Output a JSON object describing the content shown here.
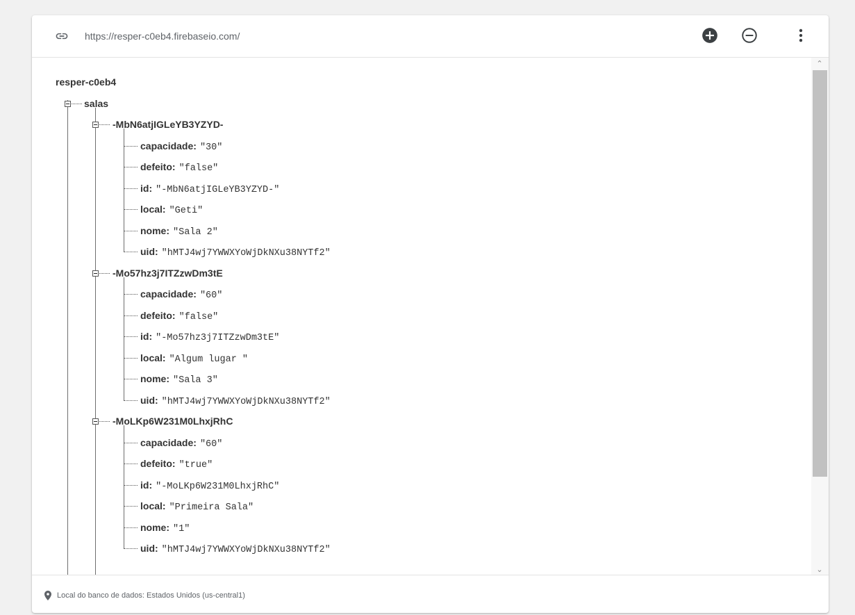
{
  "header": {
    "url": "https://resper-c0eb4.firebaseio.com/",
    "icons": {
      "link": "link-icon",
      "add": "add-circle-icon",
      "remove": "remove-circle-icon",
      "more": "more-vert-icon"
    }
  },
  "tree": {
    "root": "resper-c0eb4",
    "collection": "salas",
    "records": [
      {
        "key": "-MbN6atjIGLeYB3YZYD-",
        "fields": [
          {
            "key": "capacidade:",
            "value": "\"30\""
          },
          {
            "key": "defeito:",
            "value": "\"false\""
          },
          {
            "key": "id:",
            "value": "\"-MbN6atjIGLeYB3YZYD-\""
          },
          {
            "key": "local:",
            "value": "\"Geti\""
          },
          {
            "key": "nome:",
            "value": "\"Sala 2\""
          },
          {
            "key": "uid:",
            "value": "\"hMTJ4wj7YWWXYoWjDkNXu38NYTf2\""
          }
        ]
      },
      {
        "key": "-Mo57hz3j7ITZzwDm3tE",
        "fields": [
          {
            "key": "capacidade:",
            "value": "\"60\""
          },
          {
            "key": "defeito:",
            "value": "\"false\""
          },
          {
            "key": "id:",
            "value": "\"-Mo57hz3j7ITZzwDm3tE\""
          },
          {
            "key": "local:",
            "value": "\"Algum lugar \""
          },
          {
            "key": "nome:",
            "value": "\"Sala 3\""
          },
          {
            "key": "uid:",
            "value": "\"hMTJ4wj7YWWXYoWjDkNXu38NYTf2\""
          }
        ]
      },
      {
        "key": "-MoLKp6W231M0LhxjRhC",
        "fields": [
          {
            "key": "capacidade:",
            "value": "\"60\""
          },
          {
            "key": "defeito:",
            "value": "\"true\""
          },
          {
            "key": "id:",
            "value": "\"-MoLKp6W231M0LhxjRhC\""
          },
          {
            "key": "local:",
            "value": "\"Primeira Sala\""
          },
          {
            "key": "nome:",
            "value": "\"1\""
          },
          {
            "key": "uid:",
            "value": "\"hMTJ4wj7YWWXYoWjDkNXu38NYTf2\""
          }
        ]
      }
    ]
  },
  "footer": {
    "location": "Local do banco de dados: Estados Unidos (us-central1)",
    "icon": "location-pin-icon"
  },
  "colors": {
    "background": "#f1f1f1",
    "card": "#ffffff",
    "text": "#333333",
    "muted": "#5f6368",
    "scroll_thumb": "#c1c1c1"
  }
}
